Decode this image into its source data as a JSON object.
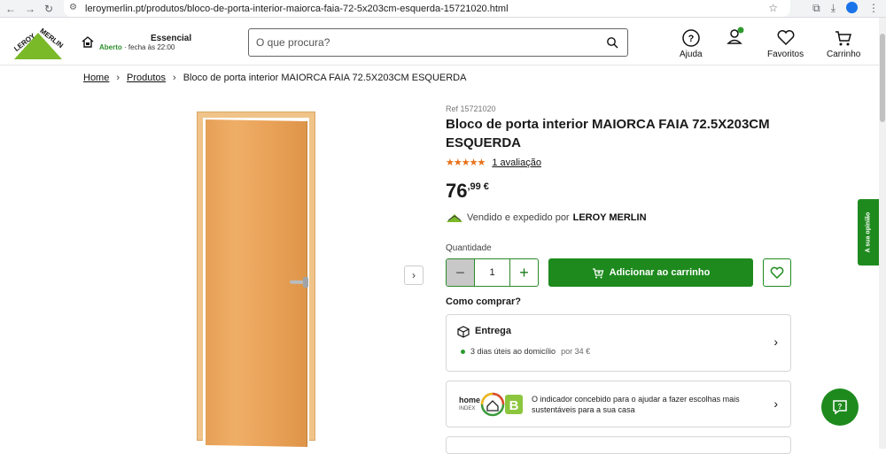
{
  "browser": {
    "url": "leroymerlin.pt/produtos/bloco-de-porta-interior-maiorca-faia-72-5x203cm-esquerda-15721020.html"
  },
  "header": {
    "logo_text": "LEROY MERLIN",
    "store_name": "Essencial",
    "store_open": "Aberto",
    "store_hours": " · fecha às 22:00",
    "search_placeholder": "O que procura?",
    "help_label": "Ajuda",
    "favorites_label": "Favoritos",
    "cart_label": "Carrinho"
  },
  "breadcrumb": {
    "home": "Home",
    "products": "Produtos",
    "current": "Bloco de porta interior MAIORCA FAIA 72.5X203CM ESQUERDA"
  },
  "product": {
    "ref": "Ref 15721020",
    "title": "Bloco de porta interior MAIORCA FAIA 72.5X203CM ESQUERDA",
    "stars": "★★★★★",
    "rating_rate": 5,
    "reviews_link": "1 avaliação",
    "price_int": "76",
    "price_dec": ",99",
    "price_currency": "€",
    "seller_prefix": "Vendido e expedido por ",
    "seller_name": "LEROY MERLIN",
    "quantity_label": "Quantidade",
    "quantity_value": "1",
    "add_to_cart": "Adicionar ao carrinho",
    "how_to_buy": "Como comprar?",
    "delivery_title": "Entrega",
    "delivery_time": "3 dias úteis ao domicílio",
    "delivery_price": "por 34 €",
    "homeindex_brand": "home",
    "homeindex_sub": "INDEX",
    "homeindex_grade": "B",
    "homeindex_text": "O indicador concebido para o ajudar a fazer escolhas mais sustentáveis para a sua casa"
  },
  "side": {
    "feedback_label": "A sua opinião"
  },
  "colors": {
    "brand_green": "#1e8a1e",
    "star_orange": "#e8711a"
  }
}
